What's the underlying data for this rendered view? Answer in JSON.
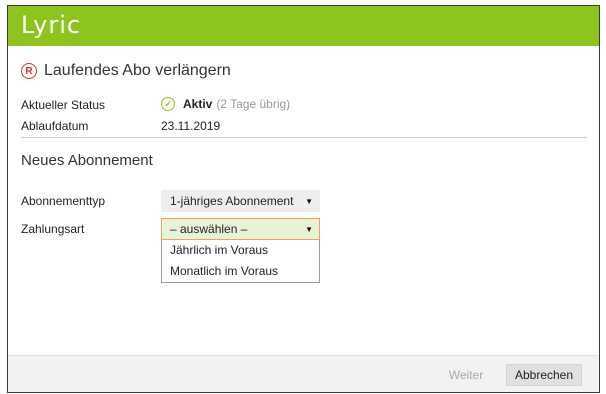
{
  "app": {
    "logo": "Lyric"
  },
  "dialog": {
    "title": "Laufendes Abo verlängern",
    "title_icon": "registered-icon",
    "status_label": "Aktueller Status",
    "status_value": "Aktiv",
    "status_remaining": "(2 Tage übrig)",
    "status_icon": "check-circle-icon",
    "expiry_label": "Ablaufdatum",
    "expiry_value": "23.11.2019"
  },
  "new_subscription": {
    "heading": "Neues Abonnement",
    "type_label": "Abonnementtyp",
    "type_value": "1-jähriges Abonnement",
    "payment_label": "Zahlungsart",
    "payment_value": "– auswählen –",
    "payment_options": [
      "Jährlich im Voraus",
      "Monatlich im Voraus"
    ]
  },
  "footer": {
    "next_label": "Weiter",
    "cancel_label": "Abbrechen"
  },
  "colors": {
    "brand": "#8dc41e",
    "accent_error": "#d0312d",
    "focus_border": "#f0a060"
  }
}
